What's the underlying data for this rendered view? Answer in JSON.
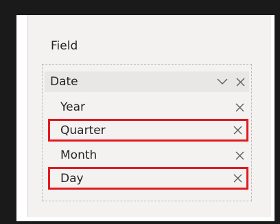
{
  "field_header": "Field",
  "date_group": {
    "label": "Date",
    "icons": [
      "chevron-down-icon",
      "close-icon"
    ]
  },
  "children": [
    {
      "label": "Year",
      "highlighted": false
    },
    {
      "label": "Quarter",
      "highlighted": true
    },
    {
      "label": "Month",
      "highlighted": false
    },
    {
      "label": "Day",
      "highlighted": true
    }
  ],
  "colors": {
    "highlight": "#e0191e",
    "panel": "#f3f2f1",
    "text": "#252423"
  }
}
